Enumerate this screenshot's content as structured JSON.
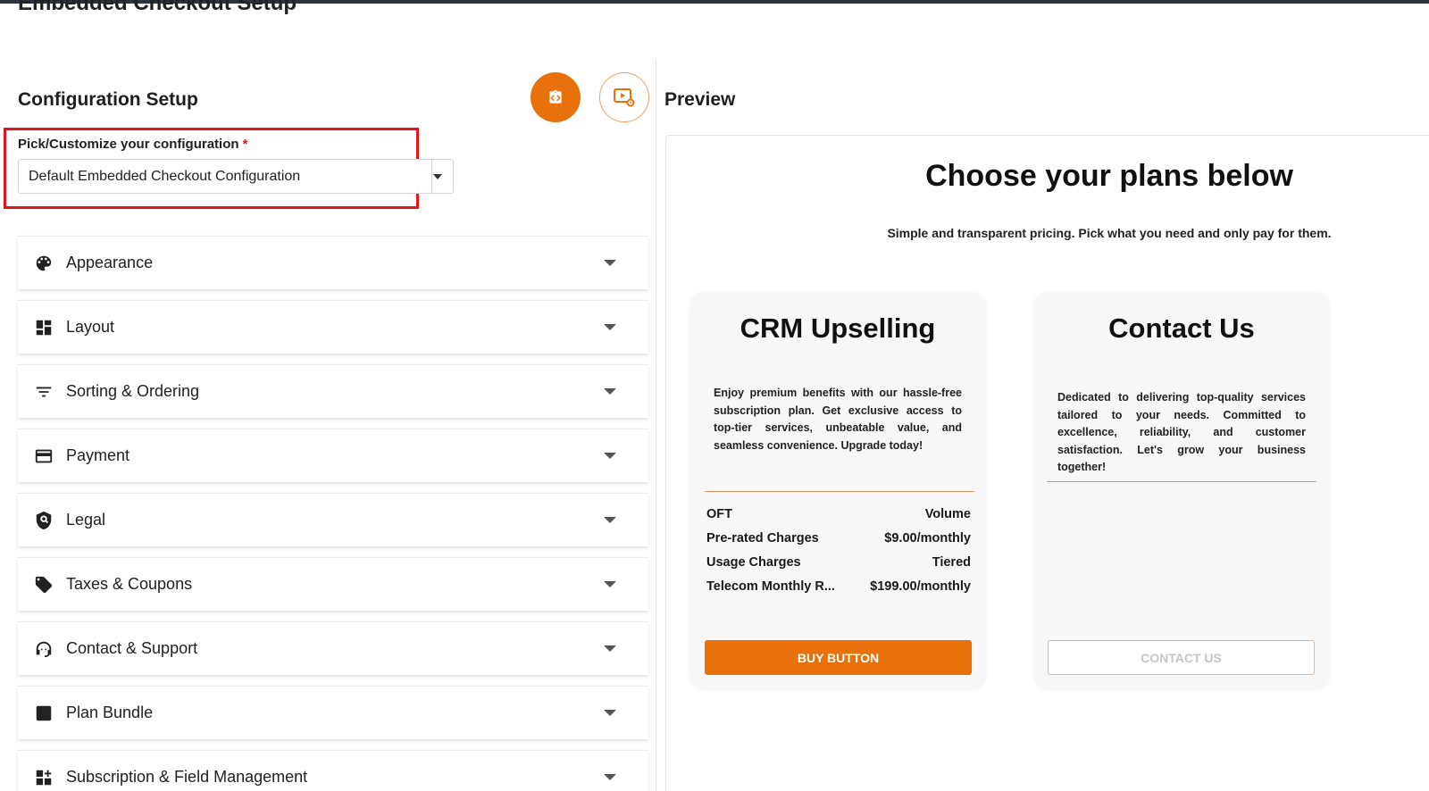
{
  "page": {
    "title": "Embedded Checkout Setup"
  },
  "config": {
    "title": "Configuration Setup",
    "field_label": "Pick/Customize your configuration",
    "required_mark": "*",
    "selected": "Default Embedded Checkout Configuration"
  },
  "icons": {
    "code_button": "code-clipboard-icon",
    "preview_button": "preview-settings-icon"
  },
  "accordion": [
    {
      "label": "Appearance",
      "icon": "palette-icon"
    },
    {
      "label": "Layout",
      "icon": "dashboard-icon"
    },
    {
      "label": "Sorting & Ordering",
      "icon": "sort-icon"
    },
    {
      "label": "Payment",
      "icon": "credit-card-icon"
    },
    {
      "label": "Legal",
      "icon": "shield-search-icon"
    },
    {
      "label": "Taxes & Coupons",
      "icon": "tag-icon"
    },
    {
      "label": "Contact & Support",
      "icon": "support-agent-icon"
    },
    {
      "label": "Plan Bundle",
      "icon": "checklist-icon"
    },
    {
      "label": "Subscription & Field Management",
      "icon": "widgets-add-icon"
    }
  ],
  "preview": {
    "title": "Preview",
    "heading": "Choose your plans below",
    "subheading": "Simple and transparent pricing. Pick what you need and only pay for them.",
    "cards": [
      {
        "title": "CRM Upselling",
        "description": "Enjoy premium benefits with our hassle-free subscription plan. Get exclusive access to top-tier services, unbeatable value, and seamless convenience. Upgrade today!",
        "charges": [
          {
            "name": "OFT",
            "value": "Volume"
          },
          {
            "name": "Pre-rated Charges",
            "value": "$9.00/monthly"
          },
          {
            "name": "Usage Charges",
            "value": "Tiered"
          },
          {
            "name": "Telecom Monthly R...",
            "value": "$199.00/monthly"
          }
        ],
        "button": "BUY BUTTON"
      },
      {
        "title": "Contact Us",
        "description": "Dedicated to delivering top-quality services tailored to your needs. Committed to excellence, reliability, and customer satisfaction. Let's grow your business together!",
        "button": "CONTACT US"
      }
    ]
  },
  "colors": {
    "accent": "#e8710c",
    "highlight": "#e4161c"
  }
}
